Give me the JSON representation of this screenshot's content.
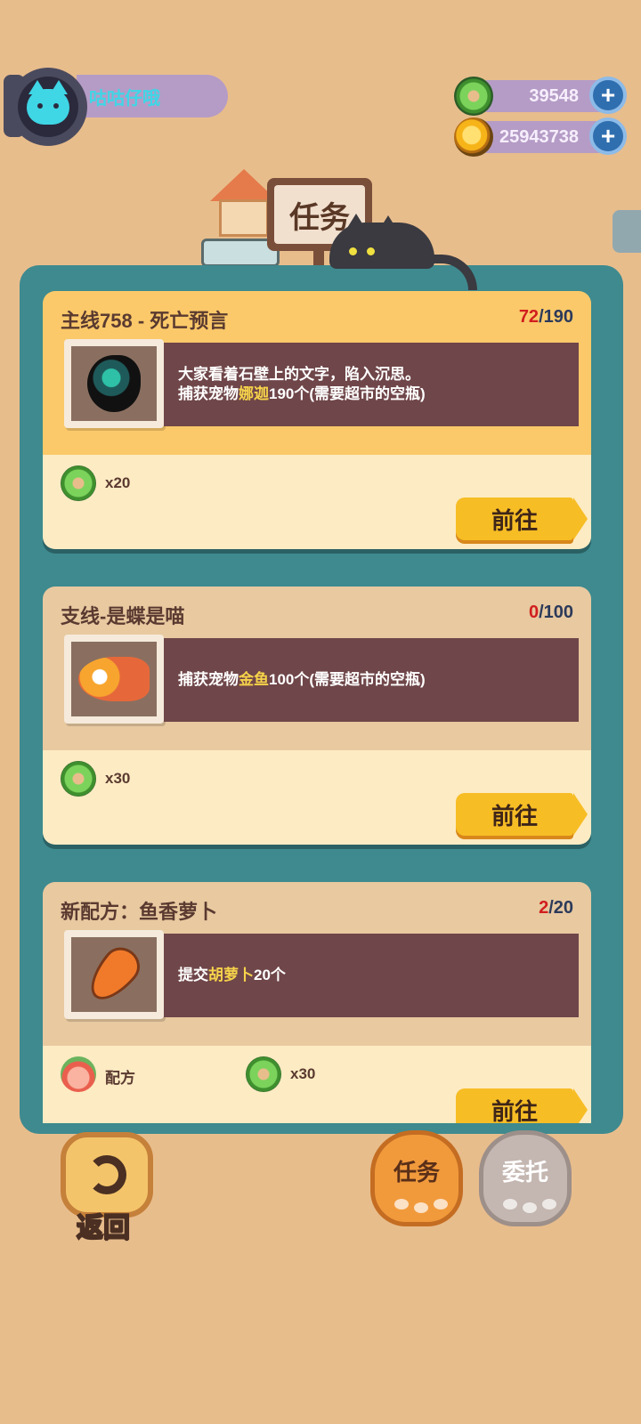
{
  "user": {
    "name": "咕咕仔哦"
  },
  "currencies": [
    {
      "icon": "green-donut-icon",
      "value": "39548"
    },
    {
      "icon": "gold-coin-icon",
      "value": "25943738"
    }
  ],
  "header": {
    "title": "任务"
  },
  "quests": [
    {
      "title": "主线758 - 死亡预言",
      "progress_current": "72",
      "progress_sep": "/",
      "progress_total": "190",
      "desc_line1": "大家看着石壁上的文字，陷入沉思。",
      "desc_line2_prefix": "捕获宠物",
      "desc_line2_highlight": "娜迦",
      "desc_line2_suffix": "190个(需要超市的空瓶)",
      "reward_amount": "x20",
      "go_label": "前往"
    },
    {
      "title": "支线-是蝶是喵",
      "progress_current": "0",
      "progress_sep": "/",
      "progress_total": "100",
      "desc_line1_prefix": "捕获宠物",
      "desc_line1_highlight": "金鱼",
      "desc_line1_suffix": "100个(需要超市的空瓶)",
      "reward_amount": "x30",
      "go_label": "前往"
    },
    {
      "title": "新配方：鱼香萝卜",
      "progress_current": "2",
      "progress_sep": "/",
      "progress_total": "20",
      "desc_line1_prefix": "提交",
      "desc_line1_highlight": "胡萝卜",
      "desc_line1_suffix": "20个",
      "reward1_label": "配方",
      "reward_amount": "x30",
      "go_label": "前往"
    }
  ],
  "nav": {
    "back": "返回",
    "tab_tasks": "任务",
    "tab_entrust": "委托"
  },
  "colors": {
    "accent": "#f7bd25",
    "panel": "#3e8a8f",
    "progress_current": "#d11e1e",
    "highlight": "#f6d34a"
  }
}
